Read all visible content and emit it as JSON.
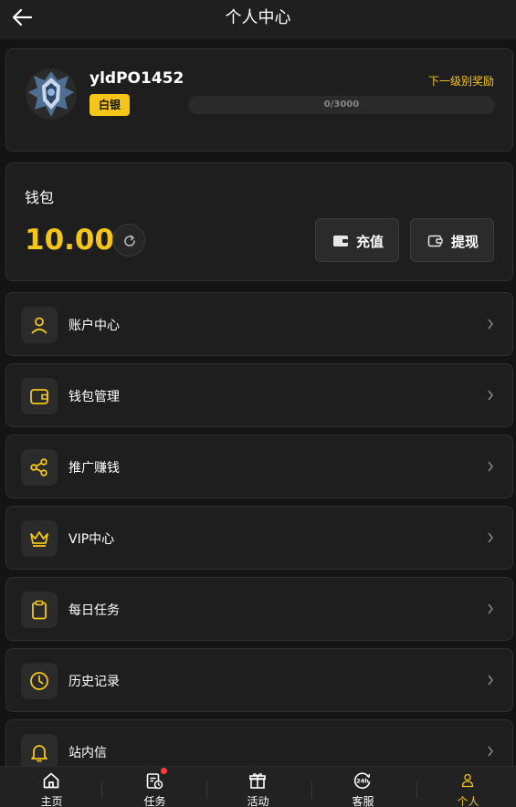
{
  "header": {
    "title": "个人中心",
    "back_icon": "arrow-left-icon"
  },
  "profile": {
    "username": "yldPO1452",
    "tier": "白银",
    "next_reward_label": "下一级别奖励",
    "progress_text": "0/3000",
    "progress_fraction": 0,
    "avatar_icon": "rank-emblem-icon"
  },
  "wallet": {
    "title": "钱包",
    "balance": "10.00",
    "deposit_label": "充值",
    "withdraw_label": "提现"
  },
  "menu": [
    {
      "label": "账户中心",
      "icon": "user-icon"
    },
    {
      "label": "钱包管理",
      "icon": "wallet-icon"
    },
    {
      "label": "推广赚钱",
      "icon": "share-icon"
    },
    {
      "label": "VIP中心",
      "icon": "crown-icon"
    },
    {
      "label": "每日任务",
      "icon": "clipboard-icon"
    },
    {
      "label": "历史记录",
      "icon": "clock-icon"
    },
    {
      "label": "站内信",
      "icon": "bell-icon"
    }
  ],
  "tabbar": [
    {
      "label": "主页",
      "icon": "home-icon"
    },
    {
      "label": "任务",
      "icon": "task-icon"
    },
    {
      "label": "活动",
      "icon": "gift-icon"
    },
    {
      "label": "客服",
      "icon": "support-24h-icon"
    },
    {
      "label": "个人",
      "icon": "person-icon",
      "active": true
    }
  ],
  "colors": {
    "accent": "#f5c518",
    "background": "#141414",
    "card": "#1e1e1e",
    "badge": "#ff3b3b"
  }
}
